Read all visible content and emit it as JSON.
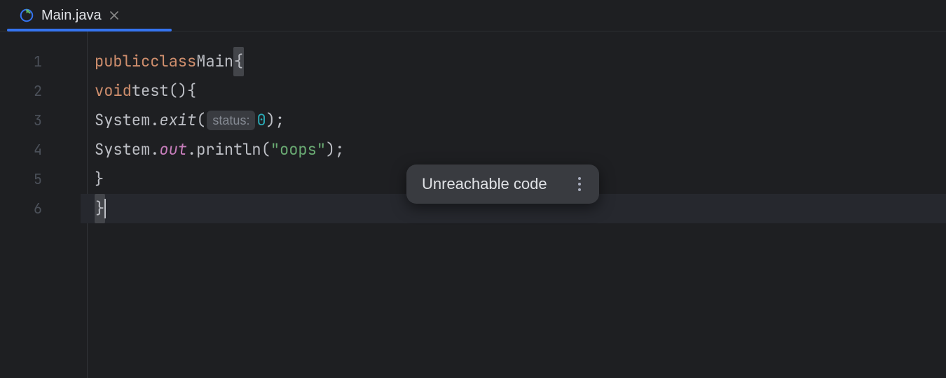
{
  "tab": {
    "title": "Main.java",
    "icon": "file-class-icon"
  },
  "gutter": [
    "1",
    "2",
    "3",
    "4",
    "5",
    "6"
  ],
  "code": {
    "l1": {
      "kw1": "public",
      "kw2": "class",
      "cls": "Main",
      "br": "{"
    },
    "l2": {
      "kw": "void",
      "name": "test",
      "parens": "()",
      "br": "{"
    },
    "l3": {
      "sys": "System",
      "dot1": ".",
      "exit": "exit",
      "op": "(",
      "hint": "status:",
      "num": "0",
      "cp": ");"
    },
    "l4": {
      "sys": "System",
      "dot1": ".",
      "out": "out",
      "dot2": ".",
      "println": "println",
      "op": "(",
      "str": "\"oops\"",
      "cp": ");"
    },
    "l5": {
      "br": "}"
    },
    "l6": {
      "br": "}"
    }
  },
  "tooltip": {
    "message": "Unreachable code"
  }
}
